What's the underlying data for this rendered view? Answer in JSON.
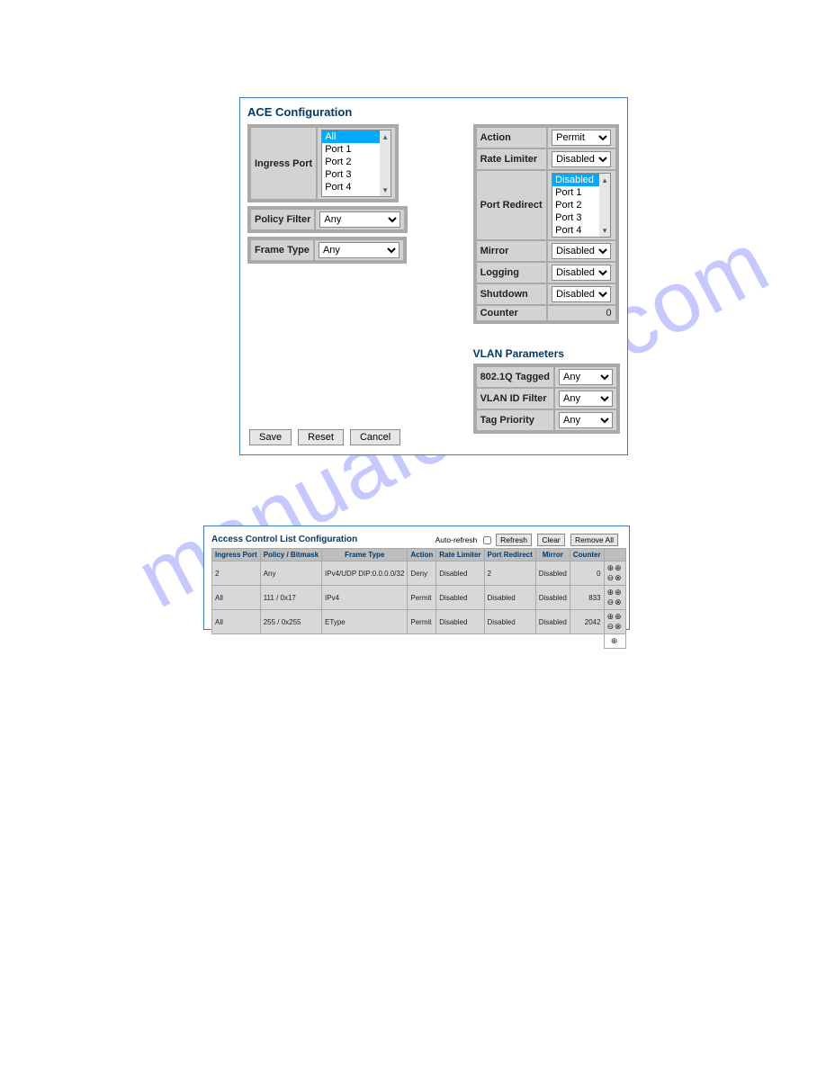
{
  "watermark": "manualchive.com",
  "ace": {
    "title": "ACE Configuration",
    "ingressPortLabel": "Ingress Port",
    "ingressPortItems": [
      "All",
      "Port 1",
      "Port 2",
      "Port 3",
      "Port 4"
    ],
    "policyFilterLabel": "Policy Filter",
    "policyFilterValue": "Any",
    "frameTypeLabel": "Frame Type",
    "frameTypeValue": "Any",
    "right": {
      "actionLabel": "Action",
      "actionValue": "Permit",
      "rateLimiterLabel": "Rate Limiter",
      "rateLimiterValue": "Disabled",
      "portRedirectLabel": "Port Redirect",
      "portRedirectItems": [
        "Disabled",
        "Port 1",
        "Port 2",
        "Port 3",
        "Port 4"
      ],
      "mirrorLabel": "Mirror",
      "mirrorValue": "Disabled",
      "loggingLabel": "Logging",
      "loggingValue": "Disabled",
      "shutdownLabel": "Shutdown",
      "shutdownValue": "Disabled",
      "counterLabel": "Counter",
      "counterValue": "0"
    },
    "vlan": {
      "title": "VLAN Parameters",
      "taggedLabel": "802.1Q Tagged",
      "taggedValue": "Any",
      "vlanIdFilterLabel": "VLAN ID Filter",
      "vlanIdFilterValue": "Any",
      "tagPriorityLabel": "Tag Priority",
      "tagPriorityValue": "Any"
    },
    "buttons": {
      "save": "Save",
      "reset": "Reset",
      "cancel": "Cancel"
    }
  },
  "acl": {
    "title": "Access Control List Configuration",
    "autoRefresh": "Auto-refresh",
    "buttons": {
      "refresh": "Refresh",
      "clear": "Clear",
      "removeAll": "Remove All"
    },
    "headers": [
      "Ingress Port",
      "Policy / Bitmask",
      "Frame Type",
      "Action",
      "Rate Limiter",
      "Port Redirect",
      "Mirror",
      "Counter"
    ],
    "rows": [
      {
        "port": "2",
        "policy": "Any",
        "frame": "IPv4/UDP DIP:0.0.0.0/32",
        "action": "Deny",
        "rate": "Disabled",
        "redirect": "2",
        "mirror": "Disabled",
        "counter": "0"
      },
      {
        "port": "All",
        "policy": "111 / 0x17",
        "frame": "IPv4",
        "action": "Permit",
        "rate": "Disabled",
        "redirect": "Disabled",
        "mirror": "Disabled",
        "counter": "833"
      },
      {
        "port": "All",
        "policy": "255 / 0x255",
        "frame": "EType",
        "action": "Permit",
        "rate": "Disabled",
        "redirect": "Disabled",
        "mirror": "Disabled",
        "counter": "2042"
      }
    ],
    "iconsGlyph": "⊕⊕\n⊖⊗",
    "plusGlyph": "⊕"
  }
}
